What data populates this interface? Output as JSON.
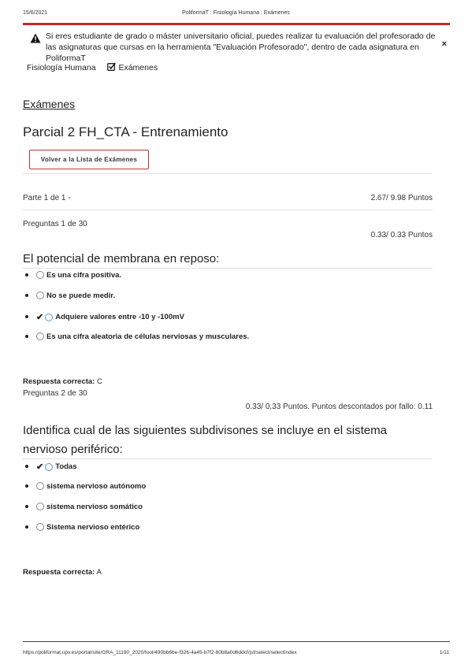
{
  "print_header": {
    "date": "15/6/2021",
    "title": "PoliformaT : Fisiología Humana : Exámenes"
  },
  "notice": {
    "text": "Si eres estudiante de grado o máster universitario oficial, puedes realizar tu evaluación del profesorado de las asignaturas que cursas en la herramienta \"Evaluación Profesorado\", dentro de cada asignatura en PoliformaT",
    "warn_icon": "warning-triangle-icon",
    "close_label": "×"
  },
  "breadcrumb": {
    "course": "Fisiología Humana",
    "tool": "Exámenes",
    "tool_icon": "checkbox-icon"
  },
  "section_title": "Exámenes",
  "exam_title": "Parcial 2 FH_CTA - Entrenamiento",
  "back_button": "Volver a la Lista de Exámenes",
  "part": {
    "label": "Parte 1 de 1 -",
    "points": "2.67/ 9.98 Puntos"
  },
  "questions": [
    {
      "counter": "Preguntas 1 de 30",
      "points": "0.33/ 0.33 Puntos",
      "text": "El potencial de membrana en reposo:",
      "options": [
        {
          "label": "Es una cifra positiva.",
          "correct": false
        },
        {
          "label": "No se puede medir.",
          "correct": false
        },
        {
          "label": "Adquiere valores entre -10 y -100mV",
          "correct": true
        },
        {
          "label": "Es una cifra aleatoria de células nerviosas y musculares.",
          "correct": false
        }
      ],
      "answer_label": "Respuesta correcta:",
      "answer_value": "C"
    },
    {
      "counter": "Preguntas 2 de 30",
      "points": "0.33/ 0.33 Puntos. Puntos descontados por fallo: 0.11",
      "text": "Identifica cual de las siguientes subdivisones se incluye en el sistema nervioso periférico:",
      "options": [
        {
          "label": "Todas",
          "correct": true
        },
        {
          "label": "sistema nervioso autónomo",
          "correct": false
        },
        {
          "label": "sistema nervioso somático",
          "correct": false
        },
        {
          "label": "Sistema nervioso entérico",
          "correct": false
        }
      ],
      "answer_label": "Respuesta correcta:",
      "answer_value": "A"
    }
  ],
  "print_footer": {
    "url": "https://poliformat.upv.es/portal/site/GRA_11190_2020/tool/490bb6be-f326-4a45-b7f2-80b8a0d6ddcf/jsf/select/selectIndex",
    "page": "1/11"
  }
}
